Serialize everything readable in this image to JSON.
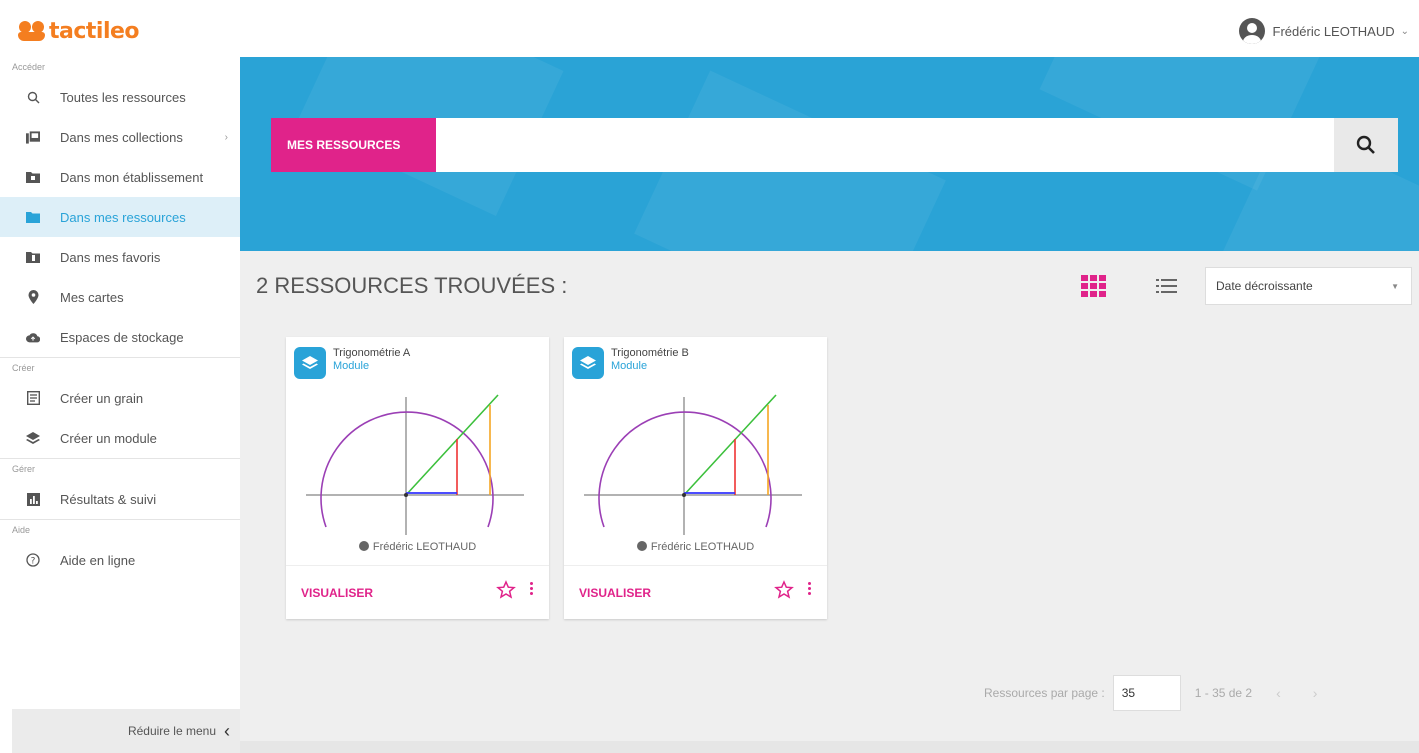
{
  "header": {
    "logo_text": "tactileo",
    "user_name": "Frédéric LEOTHAUD",
    "user_menu_chevron": "⌄"
  },
  "sidebar": {
    "sections": {
      "access": "Accéder",
      "create": "Créer",
      "manage": "Gérer",
      "help": "Aide"
    },
    "items": [
      {
        "label": "Toutes les ressources",
        "icon": "search-icon"
      },
      {
        "label": "Dans mes collections",
        "icon": "collections-icon",
        "arrow": "›"
      },
      {
        "label": "Dans mon établissement",
        "icon": "school-folder-icon"
      },
      {
        "label": "Dans mes ressources",
        "icon": "folder-icon"
      },
      {
        "label": "Dans mes favoris",
        "icon": "favorites-folder-icon"
      },
      {
        "label": "Mes cartes",
        "icon": "map-pin-icon"
      },
      {
        "label": "Espaces de stockage",
        "icon": "cloud-icon"
      },
      {
        "label": "Créer un grain",
        "icon": "grain-icon"
      },
      {
        "label": "Créer un module",
        "icon": "layers-icon"
      },
      {
        "label": "Résultats & suivi",
        "icon": "chart-icon"
      },
      {
        "label": "Aide en ligne",
        "icon": "help-icon"
      }
    ],
    "collapse_label": "Réduire le menu"
  },
  "search": {
    "scope_label": "MES RESSOURCES",
    "placeholder": ""
  },
  "results": {
    "title": "2 RESSOURCES TROUVÉES :",
    "sort_label": "Date décroissante",
    "cards": [
      {
        "title": "Trigonométrie A",
        "type": "Module",
        "author": "Frédéric LEOTHAUD",
        "action": "VISUALISER"
      },
      {
        "title": "Trigonométrie B",
        "type": "Module",
        "author": "Frédéric LEOTHAUD",
        "action": "VISUALISER"
      }
    ]
  },
  "pagination": {
    "per_page_label": "Ressources par page :",
    "per_page_value": "35",
    "range": "1 - 35 de 2",
    "prev": "‹",
    "next": "›"
  },
  "colors": {
    "brand_orange": "#f47e20",
    "accent_pink": "#e0238a",
    "banner_blue": "#2aa3d6"
  }
}
